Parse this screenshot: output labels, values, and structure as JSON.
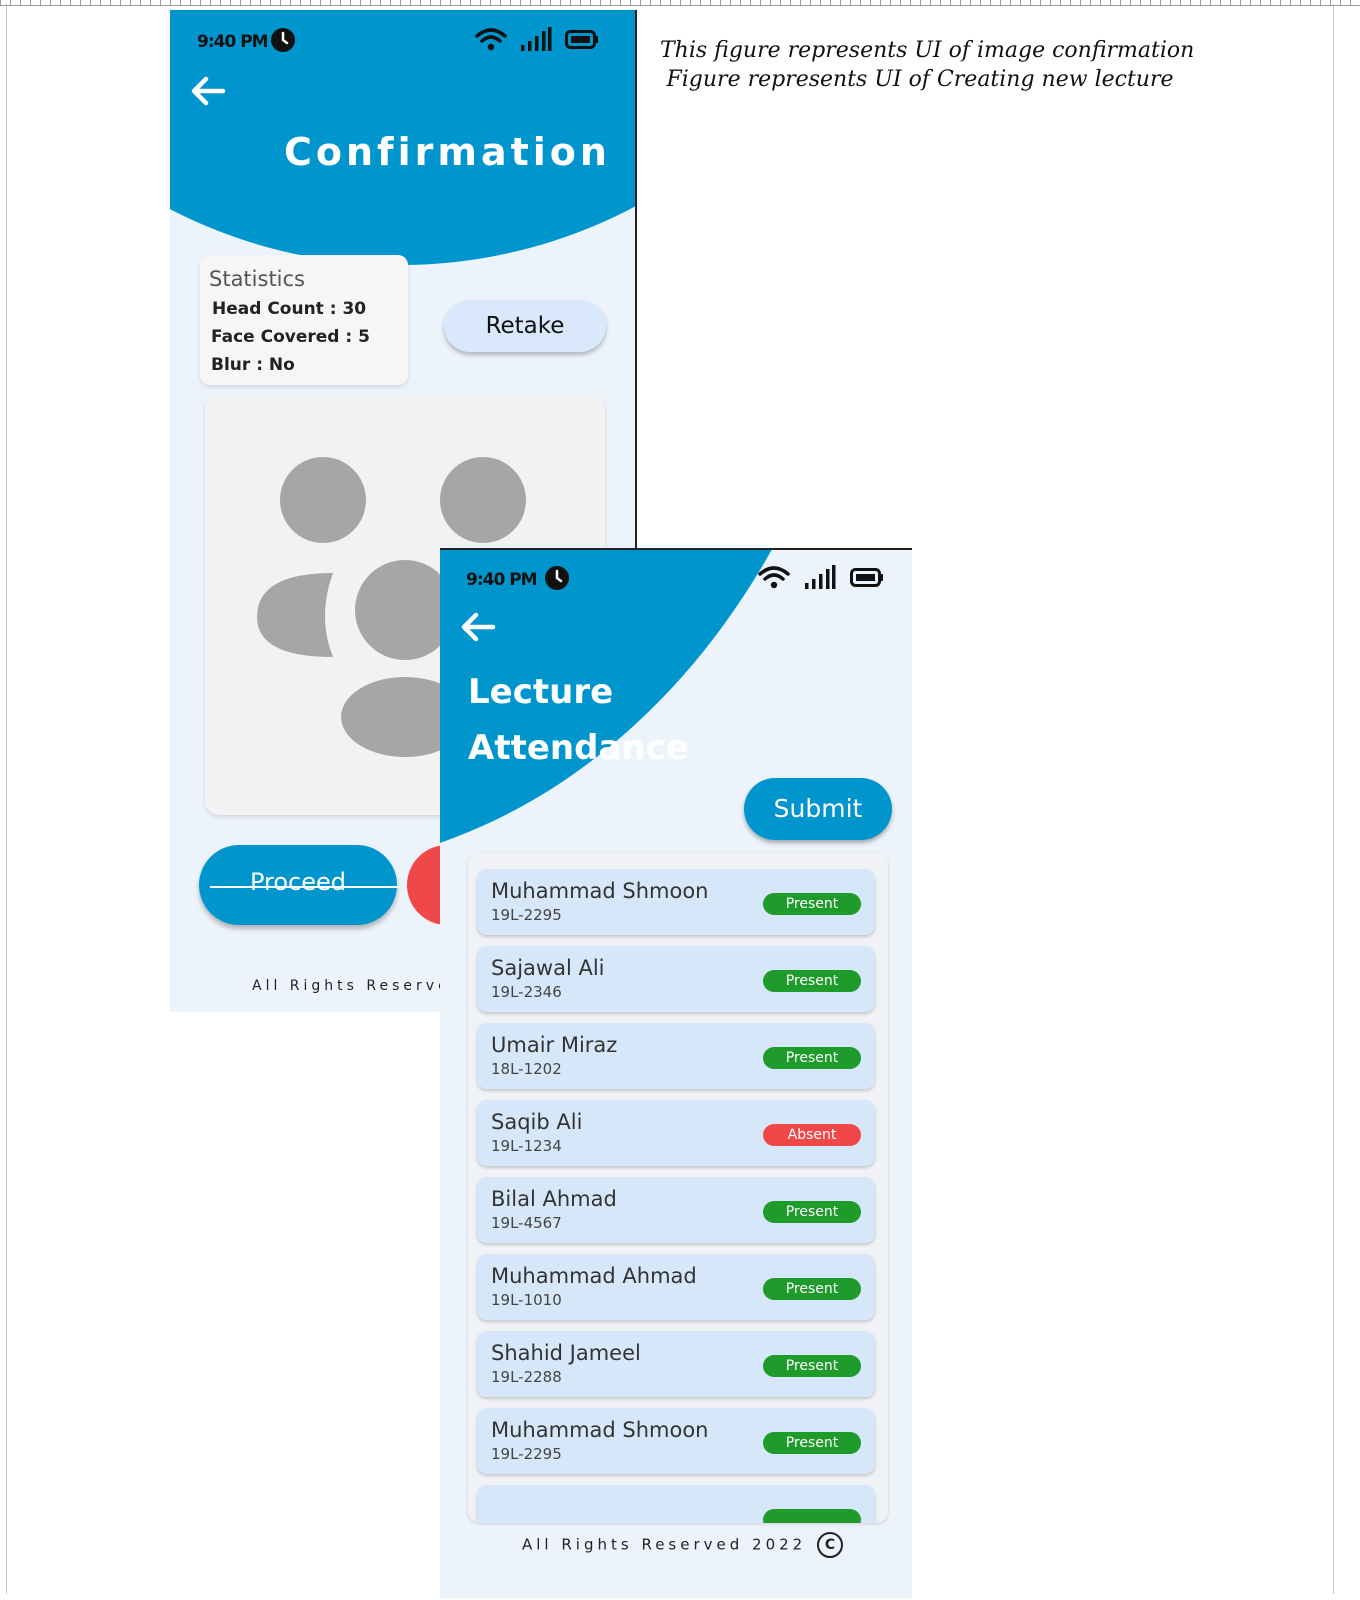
{
  "captions": {
    "line1": "This figure represents UI of image confirmation",
    "line2": "Figure represents UI of Creating new lecture"
  },
  "colors": {
    "primary": "#0096cd",
    "background": "#edf3fb",
    "present": "#1f9b2c",
    "absent": "#f04848"
  },
  "confirmation_screen": {
    "status_time": "9:40 PM",
    "title": "Confirmation",
    "statistics": {
      "title": "Statistics",
      "head_count_label": "Head Count :",
      "head_count_value": "30",
      "face_covered_label": "Face Covered :",
      "face_covered_value": "5",
      "blur_label": "Blur :",
      "blur_value": "No"
    },
    "retake_label": "Retake",
    "proceed_label": "Proceed",
    "footer": "All Rights Reserve"
  },
  "attendance_screen": {
    "status_time": "9:40 PM",
    "title_line1": "Lecture",
    "title_line2": "Attendance",
    "submit_label": "Submit",
    "students": [
      {
        "name": "Muhammad Shmoon",
        "roll": "19L-2295",
        "status": "Present"
      },
      {
        "name": "Sajawal Ali",
        "roll": "19L-2346",
        "status": "Present"
      },
      {
        "name": "Umair Miraz",
        "roll": "18L-1202",
        "status": "Present"
      },
      {
        "name": "Saqib Ali",
        "roll": "19L-1234",
        "status": "Absent"
      },
      {
        "name": "Bilal Ahmad",
        "roll": "19L-4567",
        "status": "Present"
      },
      {
        "name": "Muhammad Ahmad",
        "roll": "19L-1010",
        "status": "Present"
      },
      {
        "name": "Shahid Jameel",
        "roll": "19L-2288",
        "status": "Present"
      },
      {
        "name": "Muhammad Shmoon",
        "roll": "19L-2295",
        "status": "Present"
      }
    ],
    "footer": "All Rights Reserved 2022",
    "copyright_symbol": "C"
  }
}
